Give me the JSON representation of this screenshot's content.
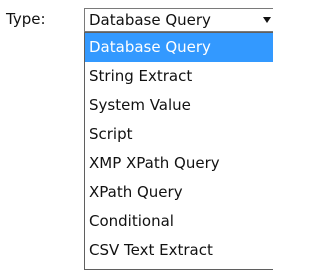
{
  "field": {
    "label": "Type:",
    "selected_value": "Database Query"
  },
  "dropdown": {
    "options": [
      {
        "label": "Database Query",
        "selected": true
      },
      {
        "label": "String Extract",
        "selected": false
      },
      {
        "label": "System Value",
        "selected": false
      },
      {
        "label": "Script",
        "selected": false
      },
      {
        "label": "XMP XPath Query",
        "selected": false
      },
      {
        "label": "XPath Query",
        "selected": false
      },
      {
        "label": "Conditional",
        "selected": false
      },
      {
        "label": "CSV Text Extract",
        "selected": false
      }
    ]
  },
  "colors": {
    "selected_background": "#3399ff",
    "selected_text": "#ffffff",
    "border": "#7a7a7a"
  }
}
